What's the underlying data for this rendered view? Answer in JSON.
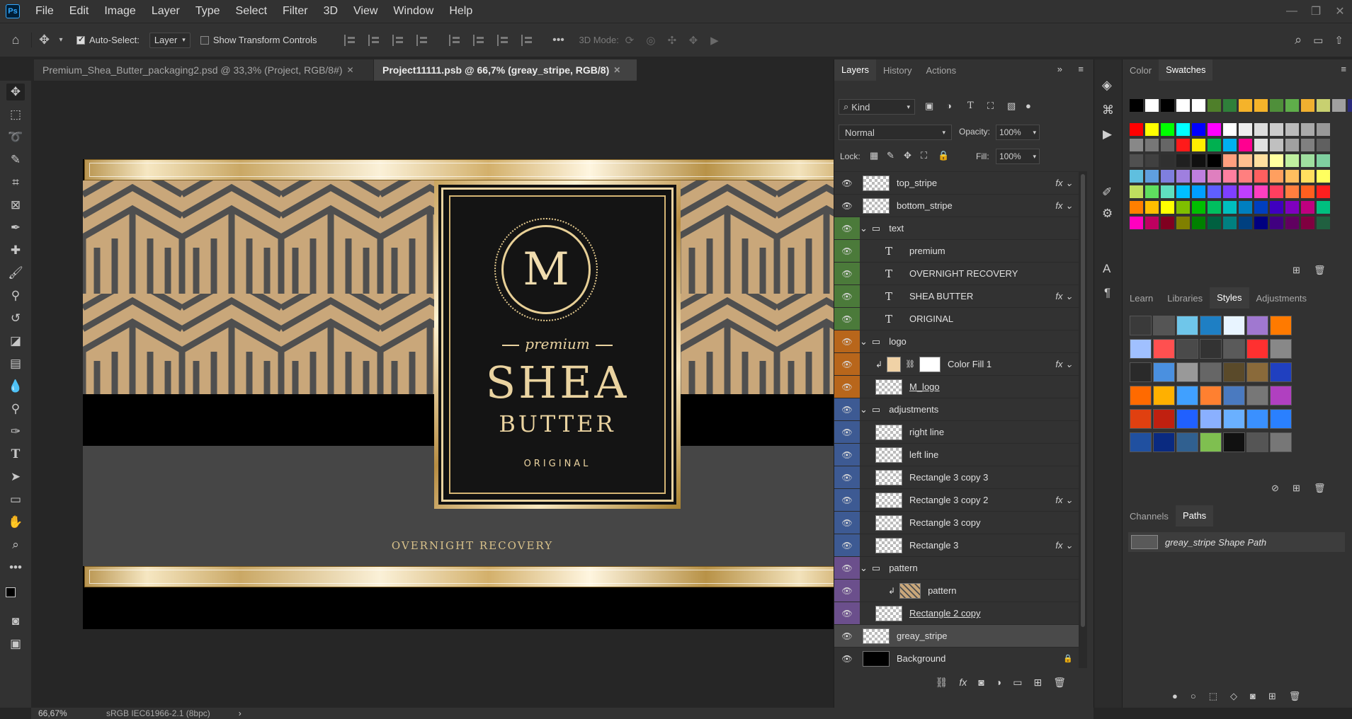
{
  "app": {
    "logo": "Ps",
    "menu": [
      "File",
      "Edit",
      "Image",
      "Layer",
      "Type",
      "Select",
      "Filter",
      "3D",
      "View",
      "Window",
      "Help"
    ],
    "window_controls": [
      "—",
      "❐",
      "✕"
    ]
  },
  "options_bar": {
    "auto_select_label": "Auto-Select:",
    "auto_select_checked": true,
    "auto_select_target": "Layer",
    "show_transform_label": "Show Transform Controls",
    "show_transform_checked": false,
    "more": "•••",
    "mode_3d_label": "3D Mode:"
  },
  "tabs": [
    {
      "label": "Premium_Shea_Butter_packaging2.psd @ 33,3% (Project, RGB/8#)",
      "close": "✕",
      "active": false
    },
    {
      "label": "Project11111.psb @ 66,7% (greay_stripe, RGB/8)",
      "close": "✕",
      "active": true
    }
  ],
  "artwork": {
    "logo_letter": "M",
    "premium": "premium",
    "shea": "SHEA",
    "butter": "BUTTER",
    "original": "ORIGINAL",
    "overnight": "OVERNIGHT RECOVERY",
    "colors": {
      "gold": "#c9a46b",
      "pattern_bg": "#c9a77a",
      "pattern_line": "#4f4f4f",
      "label_bg": "#141414",
      "gray_stripe": "#464646"
    }
  },
  "layers_panel": {
    "tabs": [
      "Layers",
      "History",
      "Actions"
    ],
    "active_tab": "Layers",
    "filter_kind": "Kind",
    "blend_mode": "Normal",
    "opacity_label": "Opacity:",
    "opacity_value": "100%",
    "lock_label": "Lock:",
    "fill_label": "Fill:",
    "fill_value": "100%",
    "layers": [
      {
        "name": "top_stripe",
        "type": "shape",
        "indent": 0,
        "fx": true,
        "color": ""
      },
      {
        "name": "bottom_stripe",
        "type": "shape",
        "indent": 0,
        "fx": true,
        "color": ""
      },
      {
        "name": "text",
        "type": "group",
        "indent": 0,
        "fx": false,
        "color": "#4b7a3a"
      },
      {
        "name": "premium",
        "type": "text",
        "indent": 1,
        "fx": false,
        "color": "#4b7a3a"
      },
      {
        "name": "OVERNIGHT RECOVERY",
        "type": "text",
        "indent": 1,
        "fx": false,
        "color": "#4b7a3a"
      },
      {
        "name": "SHEA BUTTER",
        "type": "text",
        "indent": 1,
        "fx": true,
        "color": "#4b7a3a"
      },
      {
        "name": "ORIGINAL",
        "type": "text",
        "indent": 1,
        "fx": false,
        "color": "#4b7a3a"
      },
      {
        "name": "logo",
        "type": "group",
        "indent": 0,
        "fx": false,
        "color": "#b8661b"
      },
      {
        "name": "Color Fill 1",
        "type": "fill",
        "indent": 1,
        "fx": true,
        "color": "#b8661b"
      },
      {
        "name": "M_logo",
        "type": "smart",
        "indent": 1,
        "fx": false,
        "color": "#b8661b"
      },
      {
        "name": "adjustments",
        "type": "group",
        "indent": 0,
        "fx": false,
        "color": "#3d5a93"
      },
      {
        "name": "right line",
        "type": "shape",
        "indent": 1,
        "fx": false,
        "color": "#3d5a93"
      },
      {
        "name": "left line",
        "type": "shape",
        "indent": 1,
        "fx": false,
        "color": "#3d5a93"
      },
      {
        "name": "Rectangle 3 copy 3",
        "type": "shape",
        "indent": 1,
        "fx": false,
        "color": "#3d5a93"
      },
      {
        "name": "Rectangle 3 copy 2",
        "type": "shape",
        "indent": 1,
        "fx": true,
        "color": "#3d5a93"
      },
      {
        "name": "Rectangle 3 copy",
        "type": "shape",
        "indent": 1,
        "fx": false,
        "color": "#3d5a93"
      },
      {
        "name": "Rectangle 3",
        "type": "shape",
        "indent": 1,
        "fx": true,
        "color": "#3d5a93"
      },
      {
        "name": "pattern",
        "type": "group",
        "indent": 0,
        "fx": false,
        "color": "#6b4f8c"
      },
      {
        "name": "pattern",
        "type": "clip",
        "indent": 2,
        "fx": false,
        "color": "#6b4f8c"
      },
      {
        "name": "Rectangle 2 copy",
        "type": "shape",
        "indent": 1,
        "fx": false,
        "color": "#6b4f8c"
      },
      {
        "name": "greay_stripe",
        "type": "shape",
        "indent": 0,
        "fx": false,
        "color": "",
        "selected": true
      },
      {
        "name": "Background",
        "type": "background",
        "indent": 0,
        "fx": false,
        "color": "",
        "locked": true
      }
    ]
  },
  "color_panel": {
    "tabs": [
      "Color",
      "Swatches"
    ],
    "active_tab": "Swatches"
  },
  "styles_panel": {
    "tabs": [
      "Learn",
      "Libraries",
      "Styles",
      "Adjustments"
    ],
    "active_tab": "Styles"
  },
  "paths_panel": {
    "tabs": [
      "Channels",
      "Paths"
    ],
    "active_tab": "Paths",
    "path_name": "greay_stripe Shape Path"
  },
  "status": {
    "zoom": "66,67%",
    "profile": "sRGB IEC61966-2.1 (8bpc)",
    "arrow": "›"
  },
  "swatch_colors": [
    [
      "#000000",
      "#ffffff",
      "#000000",
      "#ffffff",
      "#ffffff",
      "#4f7f2a",
      "#2f7f3a",
      "#f5b32a",
      "#f5b32a",
      "#4f8f3a",
      "#5fae4a",
      "#f0b030",
      "#c8d070",
      "#a0a0a0",
      "#2a2a7a"
    ],
    [
      "#ff0000",
      "#ffff00",
      "#00ff00",
      "#00ffff",
      "#0000ff",
      "#ff00ff",
      "#ffffff",
      "#eeeeee",
      "#dddddd",
      "#cccccc",
      "#bbbbbb",
      "#aaaaaa",
      "#999999"
    ],
    [
      "#888888",
      "#777777",
      "#666666",
      "#ff1a1a",
      "#ffee00",
      "#00b050",
      "#00b0f0",
      "#ff0090",
      "#e0e0e0",
      "#c0c0c0",
      "#a0a0a0",
      "#808080",
      "#606060"
    ],
    [
      "#505050",
      "#404040",
      "#303030",
      "#202020",
      "#101010",
      "#000000",
      "#ff9f7f",
      "#ffbf8f",
      "#ffdf9f",
      "#ffff9f",
      "#bfef9f",
      "#9fdf9f",
      "#7fcf9f"
    ],
    [
      "#5fbfdf",
      "#5f9fdf",
      "#7f7fdf",
      "#9f7fdf",
      "#bf7fdf",
      "#df7fbf",
      "#ff7f9f",
      "#ff7f7f",
      "#ff5f5f",
      "#ff9f5f",
      "#ffbf5f",
      "#ffdf5f",
      "#ffff5f"
    ],
    [
      "#bfdf5f",
      "#5fdf5f",
      "#5fdfbf",
      "#00bfff",
      "#009fff",
      "#5f5fff",
      "#7f3fff",
      "#bf3fff",
      "#ff3fbf",
      "#ff3f5f",
      "#ff7f3f",
      "#ff5f1f",
      "#ff1f1f"
    ],
    [
      "#ff7f00",
      "#ffbf00",
      "#ffff00",
      "#7fbf00",
      "#00bf00",
      "#00bf5f",
      "#00bfbf",
      "#007fbf",
      "#003fbf",
      "#3f00bf",
      "#7f00bf",
      "#bf007f",
      "#00bf7f"
    ],
    [
      "#ff00bf",
      "#bf0060",
      "#800020",
      "#808000",
      "#008000",
      "#006040",
      "#008080",
      "#004080",
      "#000080",
      "#400080",
      "#600060",
      "#800040",
      "#206040"
    ]
  ]
}
